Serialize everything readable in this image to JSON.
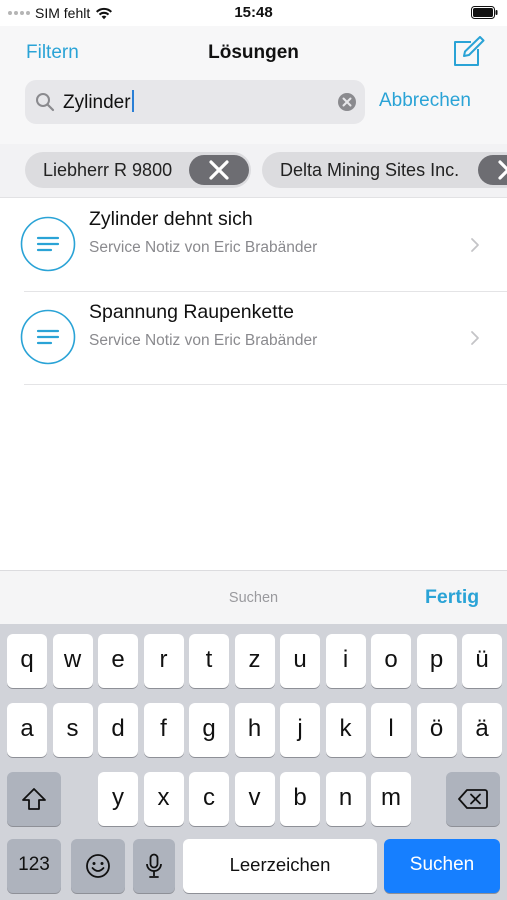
{
  "status_bar": {
    "carrier": "SIM fehlt",
    "time": "15:48"
  },
  "nav": {
    "filter_label": "Filtern",
    "title": "Lösungen",
    "compose_icon": "compose-icon"
  },
  "search": {
    "value": "Zylinder",
    "cancel_label": "Abbrechen"
  },
  "chips": [
    {
      "label": "Liebherr R 9800"
    },
    {
      "label": "Delta Mining Sites Inc."
    }
  ],
  "results": [
    {
      "title": "Zylinder dehnt sich",
      "subtitle": "Service Notiz von Eric Brabänder"
    },
    {
      "title": "Spannung Raupenkette",
      "subtitle": "Service Notiz von Eric Brabänder"
    }
  ],
  "accessory": {
    "title": "Suchen",
    "done_label": "Fertig"
  },
  "keyboard": {
    "row1": [
      "q",
      "w",
      "e",
      "r",
      "t",
      "z",
      "u",
      "i",
      "o",
      "p",
      "ü"
    ],
    "row2": [
      "a",
      "s",
      "d",
      "f",
      "g",
      "h",
      "j",
      "k",
      "l",
      "ö",
      "ä"
    ],
    "row3": [
      "y",
      "x",
      "c",
      "v",
      "b",
      "n",
      "m"
    ],
    "numbers_label": "123",
    "space_label": "Leerzeichen",
    "search_label": "Suchen"
  },
  "colors": {
    "accent": "#2aa3d6",
    "key_action": "#167fff"
  }
}
